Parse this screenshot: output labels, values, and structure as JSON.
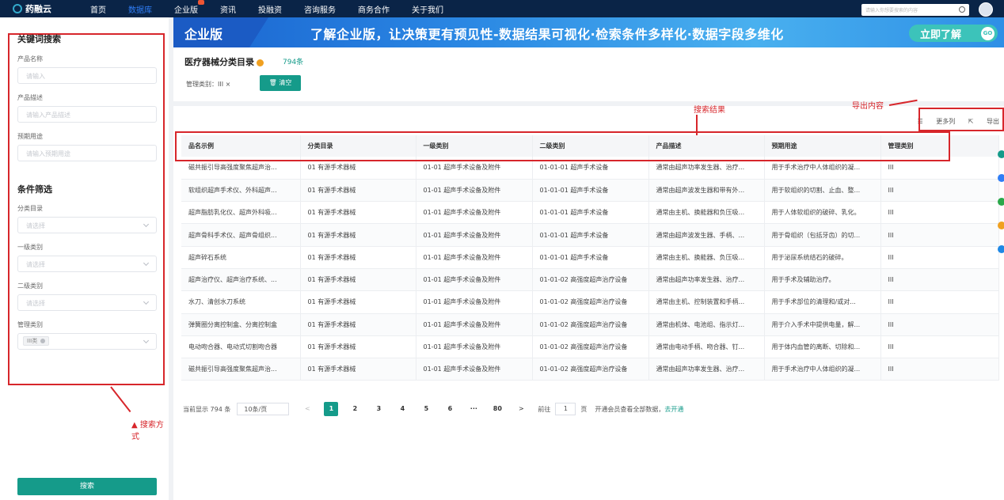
{
  "nav": {
    "logo": "药融云",
    "items": [
      "首页",
      "数据库",
      "企业版",
      "资讯",
      "投融资",
      "咨询服务",
      "商务合作",
      "关于我们"
    ],
    "search_placeholder": "请输入你想要搜索的内容"
  },
  "left": {
    "keyword_title": "关键词搜索",
    "product_name_label": "产品名称",
    "product_name_placeholder": "请输入",
    "product_desc_label": "产品描述",
    "product_desc_placeholder": "请输入产品描述",
    "intended_use_label": "预期用途",
    "intended_use_placeholder": "请输入预期用途",
    "filter_title": "条件筛选",
    "catalog_label": "分类目录",
    "catalog_placeholder": "请选择",
    "level1_label": "一级类别",
    "level1_placeholder": "请选择",
    "level2_label": "二级类别",
    "level2_placeholder": "请选择",
    "mgmt_label": "管理类别",
    "mgmt_tag": "III类",
    "search_button": "搜索",
    "annotation": "搜索方式"
  },
  "banner": {
    "enterprise": "企业版",
    "slogan": "了解企业版，让决策更有预见性-数据结果可视化·检索条件多样化·数据字段多维化",
    "cta": "立即了解",
    "go": "GO"
  },
  "card": {
    "title": "医疗器械分类目录",
    "count": "794条",
    "filter_text": "管理类别：III ×",
    "clear_button": "清空"
  },
  "annotations": {
    "results": "搜索结果",
    "export_content": "导出内容"
  },
  "tools": {
    "more_cols": "更多列",
    "export": "导出"
  },
  "table": {
    "headers": [
      "品名示例",
      "分类目录",
      "一级类别",
      "二级类别",
      "产品描述",
      "预期用途",
      "管理类别"
    ],
    "rows": [
      [
        "磁共振引导高强度聚焦超声治...",
        "01 有源手术器械",
        "01-01 超声手术设备及附件",
        "01-01-01 超声手术设备",
        "通常由超声功率发生器、治疗...",
        "用于手术治疗中人体组织的凝...",
        "III"
      ],
      [
        "软组织超声手术仪、外科超声...",
        "01 有源手术器械",
        "01-01 超声手术设备及附件",
        "01-01-01 超声手术设备",
        "通常由超声波发生器和带有外...",
        "用于软组织的切割、止血、整...",
        "III"
      ],
      [
        "超声脂肪乳化仪、超声外科吸...",
        "01 有源手术器械",
        "01-01 超声手术设备及附件",
        "01-01-01 超声手术设备",
        "通常由主机、换能器和负压吸...",
        "用于人体软组织的破碎、乳化。",
        "III"
      ],
      [
        "超声骨科手术仪、超声骨组织...",
        "01 有源手术器械",
        "01-01 超声手术设备及附件",
        "01-01-01 超声手术设备",
        "通常由超声波发生器、手柄、...",
        "用于骨组织（包括牙齿）的切...",
        "III"
      ],
      [
        "超声碎石系统",
        "01 有源手术器械",
        "01-01 超声手术设备及附件",
        "01-01-01 超声手术设备",
        "通常由主机、换能器、负压吸...",
        "用于泌尿系统结石的破碎。",
        "III"
      ],
      [
        "超声治疗仪、超声治疗系统、...",
        "01 有源手术器械",
        "01-01 超声手术设备及附件",
        "01-01-02 高强度超声治疗设备",
        "通常由超声功率发生器、治疗...",
        "用于手术及辅助治疗。",
        "III"
      ],
      [
        "水刀、清创水刀系统",
        "01 有源手术器械",
        "01-01 超声手术设备及附件",
        "01-01-02 高强度超声治疗设备",
        "通常由主机、控制装置和手柄...",
        "用于手术部位的清理和/或对...",
        "III"
      ],
      [
        "弹簧圈分离控制盒、分离控制盒",
        "01 有源手术器械",
        "01-01 超声手术设备及附件",
        "01-01-02 高强度超声治疗设备",
        "通常由机体、电池组、指示灯...",
        "用于介入手术中提供电量，解...",
        "III"
      ],
      [
        "电动吻合器、电动式切割吻合器",
        "01 有源手术器械",
        "01-01 超声手术设备及附件",
        "01-01-02 高强度超声治疗设备",
        "通常由电动手柄、吻合器、钉...",
        "用于体内血管的离断、切除和...",
        "III"
      ],
      [
        "磁共振引导高强度聚焦超声治...",
        "01 有源手术器械",
        "01-01 超声手术设备及附件",
        "01-01-02 高强度超声治疗设备",
        "通常由超声功率发生器、治疗...",
        "用于手术治疗中人体组织的凝...",
        "III"
      ]
    ]
  },
  "pager": {
    "total": "当前显示 794 条",
    "page_size": "10条/页",
    "prev": "<",
    "pages": [
      "1",
      "2",
      "3",
      "4",
      "5",
      "6",
      "···",
      "80"
    ],
    "next": ">",
    "goto_prefix": "前往",
    "goto_value": "1",
    "goto_suffix": "页",
    "member_text": "开通会员查看全部数据，",
    "member_link": "去开通"
  },
  "colors": {
    "accent": "#159b8a",
    "nav_bg": "#0a2447",
    "annotation_red": "#d7262b"
  }
}
